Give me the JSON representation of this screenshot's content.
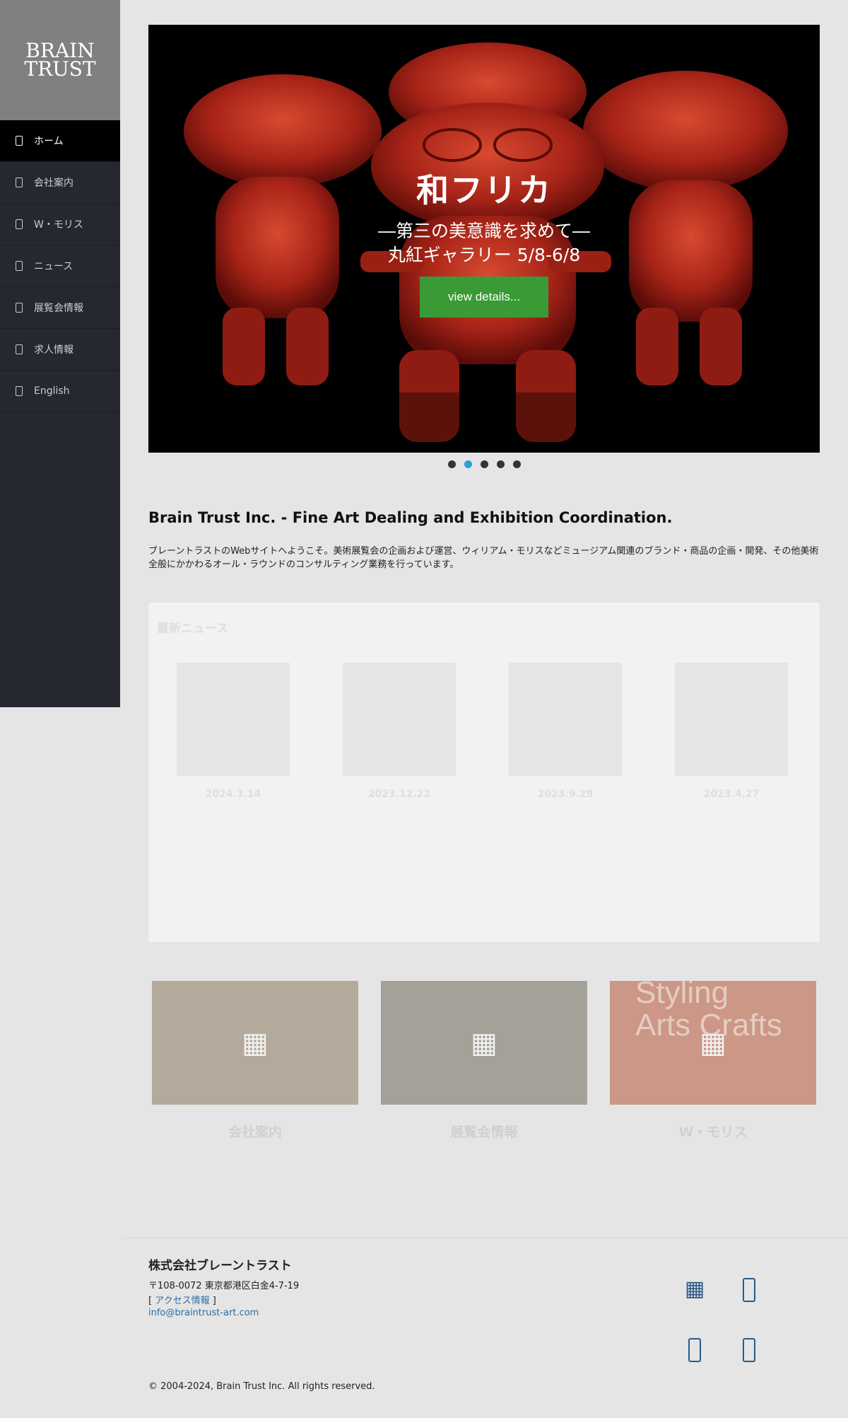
{
  "brand": {
    "line1": "BRAIN",
    "line2": "TRUST"
  },
  "nav": [
    {
      "label": "ホーム",
      "active": true
    },
    {
      "label": "会社案内"
    },
    {
      "label": "W・モリス"
    },
    {
      "label": "ニュース"
    },
    {
      "label": "展覧会情報"
    },
    {
      "label": "求人情報"
    },
    {
      "label": "English"
    }
  ],
  "hero": {
    "title": "和フリカ",
    "subtitle": "―第三の美意識を求めて―",
    "venue": "丸紅ギャラリー 5/8-6/8",
    "button": "view details...",
    "dots": 5,
    "active_dot": 2
  },
  "intro": {
    "title": "Brain Trust Inc. - Fine Art Dealing and Exhibition Coordination.",
    "text": "ブレーントラストのWebサイトへようこそ。美術展覧会の企画および運営、ウィリアム・モリスなどミュージアム関連のブランド・商品の企画・開発、その他美術全般にかかわるオール・ラウンドのコンサルティング業務を行っています。"
  },
  "news": {
    "title": "最新ニュース",
    "items": [
      {
        "date": "2024.3.14"
      },
      {
        "date": "2023.12.22"
      },
      {
        "date": "2023.9.29"
      },
      {
        "date": "2023.4.27"
      }
    ]
  },
  "cards": [
    {
      "title": "会社案内",
      "icon": "grid-icon"
    },
    {
      "title": "展覧会情報",
      "icon": "grid-icon"
    },
    {
      "title": "W・モリス",
      "icon": "grid-icon",
      "overlay": "Styling Arts Crafts"
    }
  ],
  "footer": {
    "company": "株式会社ブレーントラスト",
    "address": "〒108-0072 東京都港区白金4-7-19",
    "access_prefix": "[ ",
    "access_link": "アクセス情報",
    "access_suffix": "  ]",
    "email": "info@braintrust-art.com",
    "copyright": "© 2004-2024, Brain Trust Inc. All rights reserved."
  },
  "colors": {
    "sidebar": "#252831",
    "accent_button": "#3a9a36",
    "link": "#2c6ea3",
    "dot_active": "#2a9fd8"
  }
}
